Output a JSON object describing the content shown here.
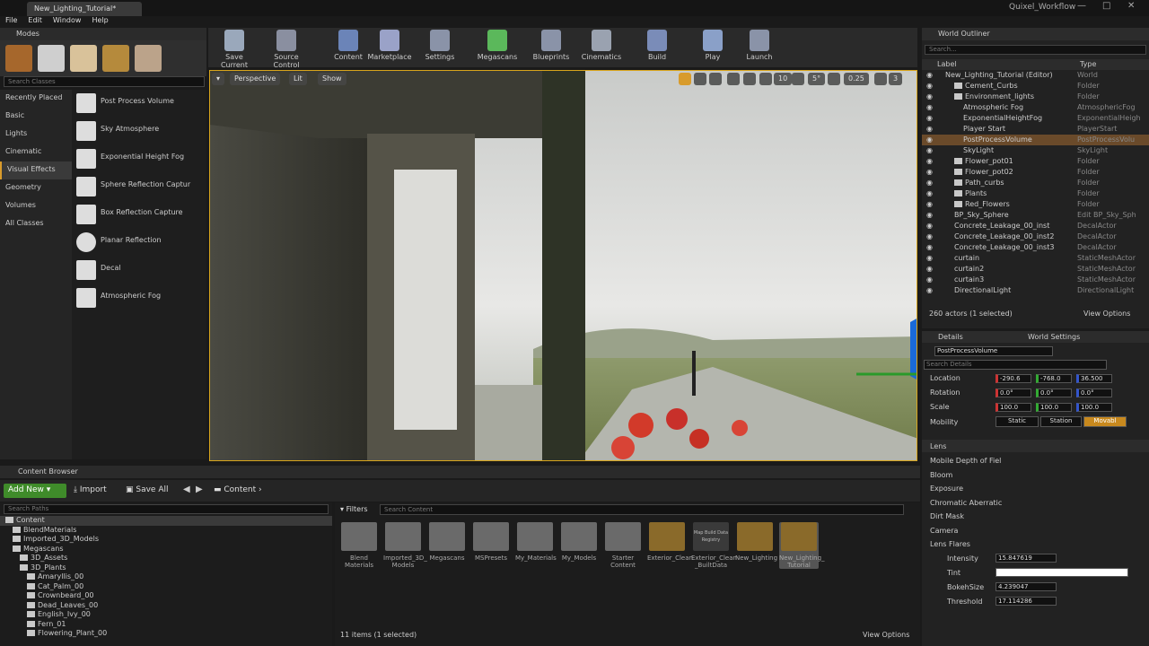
{
  "window": {
    "tab": "New_Lighting_Tutorial*",
    "title": "Quixel_Workflow"
  },
  "menu": [
    "File",
    "Edit",
    "Window",
    "Help"
  ],
  "modes": {
    "title": "Modes",
    "search_placeholder": "Search Classes"
  },
  "categories": [
    "Recently Placed",
    "Basic",
    "Lights",
    "Cinematic",
    "Visual Effects",
    "Geometry",
    "Volumes",
    "All Classes"
  ],
  "place_items": [
    "Post Process Volume",
    "Sky Atmosphere",
    "Exponential Height Fog",
    "Sphere Reflection Captur",
    "Box Reflection Capture",
    "Planar Reflection",
    "Decal",
    "Atmospheric Fog"
  ],
  "toolbar": [
    "Save Current",
    "Source Control",
    "Content",
    "Marketplace",
    "Settings",
    "Megascans",
    "Blueprints",
    "Cinematics",
    "Build",
    "Play",
    "Launch"
  ],
  "viewport": {
    "perspective": "Perspective",
    "lit": "Lit",
    "show": "Show",
    "grid": "10",
    "angle": "5°",
    "scale": "0.25",
    "speed": "3"
  },
  "outliner": {
    "title": "World Outliner",
    "search_placeholder": "Search...",
    "col_label": "Label",
    "col_type": "Type",
    "rows": [
      {
        "name": "New_Lighting_Tutorial (Editor)",
        "type": "World",
        "indent": 0,
        "folder": false
      },
      {
        "name": "Cement_Curbs",
        "type": "Folder",
        "indent": 1,
        "folder": true
      },
      {
        "name": "Environment_lights",
        "type": "Folder",
        "indent": 1,
        "folder": true
      },
      {
        "name": "Atmospheric Fog",
        "type": "AtmosphericFog",
        "indent": 2,
        "folder": false
      },
      {
        "name": "ExponentialHeightFog",
        "type": "ExponentialHeigh",
        "indent": 2,
        "folder": false
      },
      {
        "name": "Player Start",
        "type": "PlayerStart",
        "indent": 2,
        "folder": false
      },
      {
        "name": "PostProcessVolume",
        "type": "PostProcessVolu",
        "indent": 2,
        "folder": false,
        "selected": true
      },
      {
        "name": "SkyLight",
        "type": "SkyLight",
        "indent": 2,
        "folder": false
      },
      {
        "name": "Flower_pot01",
        "type": "Folder",
        "indent": 1,
        "folder": true
      },
      {
        "name": "Flower_pot02",
        "type": "Folder",
        "indent": 1,
        "folder": true
      },
      {
        "name": "Path_curbs",
        "type": "Folder",
        "indent": 1,
        "folder": true
      },
      {
        "name": "Plants",
        "type": "Folder",
        "indent": 1,
        "folder": true
      },
      {
        "name": "Red_Flowers",
        "type": "Folder",
        "indent": 1,
        "folder": true
      },
      {
        "name": "BP_Sky_Sphere",
        "type": "Edit BP_Sky_Sph",
        "indent": 1,
        "folder": false
      },
      {
        "name": "Concrete_Leakage_00_inst",
        "type": "DecalActor",
        "indent": 1,
        "folder": false
      },
      {
        "name": "Concrete_Leakage_00_inst2",
        "type": "DecalActor",
        "indent": 1,
        "folder": false
      },
      {
        "name": "Concrete_Leakage_00_inst3",
        "type": "DecalActor",
        "indent": 1,
        "folder": false
      },
      {
        "name": "curtain",
        "type": "StaticMeshActor",
        "indent": 1,
        "folder": false
      },
      {
        "name": "curtain2",
        "type": "StaticMeshActor",
        "indent": 1,
        "folder": false
      },
      {
        "name": "curtain3",
        "type": "StaticMeshActor",
        "indent": 1,
        "folder": false
      },
      {
        "name": "DirectionalLight",
        "type": "DirectionalLight",
        "indent": 1,
        "folder": false
      }
    ],
    "status": "260 actors (1 selected)",
    "view_options": "View Options"
  },
  "details": {
    "tab_details": "Details",
    "tab_world": "World Settings",
    "object": "PostProcessVolume",
    "search_placeholder": "Search Details",
    "location": {
      "label": "Location",
      "x": "-290.6",
      "y": "-768.0",
      "z": "36.500"
    },
    "rotation": {
      "label": "Rotation",
      "x": "0.0°",
      "y": "0.0°",
      "z": "0.0°"
    },
    "scale": {
      "label": "Scale",
      "x": "100.0",
      "y": "100.0",
      "z": "100.0"
    },
    "mobility": {
      "label": "Mobility",
      "static": "Static",
      "stationary": "Station",
      "movable": "Movabl"
    },
    "lens": "Lens",
    "sections": [
      "Mobile Depth of Fiel",
      "Bloom",
      "Exposure",
      "Chromatic Aberratic",
      "Dirt Mask",
      "Camera",
      "Lens Flares"
    ],
    "flares": [
      {
        "label": "Intensity",
        "value": "15.847619"
      },
      {
        "label": "Tint",
        "value": ""
      },
      {
        "label": "BokehSize",
        "value": "4.239047"
      },
      {
        "label": "Threshold",
        "value": "17.114286"
      }
    ]
  },
  "content_browser": {
    "title": "Content Browser",
    "add_new": "Add New",
    "import": "Import",
    "save_all": "Save All",
    "path": "Content",
    "search_paths": "Search Paths",
    "filters": "Filters",
    "search_content": "Search Content",
    "tree": [
      "Content",
      "BlendMaterials",
      "Imported_3D_Models",
      "Megascans",
      "3D_Assets",
      "3D_Plants",
      "Amaryllis_00",
      "Cat_Palm_00",
      "Crownbeard_00",
      "Dead_Leaves_00",
      "English_Ivy_00",
      "Fern_01",
      "Flowering_Plant_00"
    ],
    "assets": [
      "Blend Materials",
      "Imported_3D_ Models",
      "Megascans",
      "MSPresets",
      "My_Materials",
      "My_Models",
      "Starter Content",
      "Exterior_Clean",
      "Exterior_Clean _BuiltData",
      "New_Lighting",
      "New_Lighting_ Tutorial"
    ],
    "builtdata_label": "Map Build Data Registry",
    "status": "11 items (1 selected)",
    "view_options": "View Options"
  }
}
